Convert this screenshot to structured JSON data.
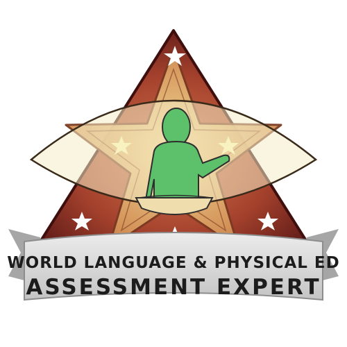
{
  "badge": {
    "line1": "WORLD LANGUAGE & PHYSICAL ED",
    "line2": "ASSESSMENT EXPERT",
    "colors": {
      "triangle_dark": "#5e1a17",
      "triangle_light": "#b5523a",
      "star_outer": "#c97a45",
      "star_inner": "#e9c27a",
      "lens": "#f4edc6",
      "figure": "#59c16a",
      "desk": "#eedcaa",
      "banner": "#d7d7d7",
      "ribbon_tail": "#9e9e9e",
      "text": "#1c1c1c"
    }
  }
}
